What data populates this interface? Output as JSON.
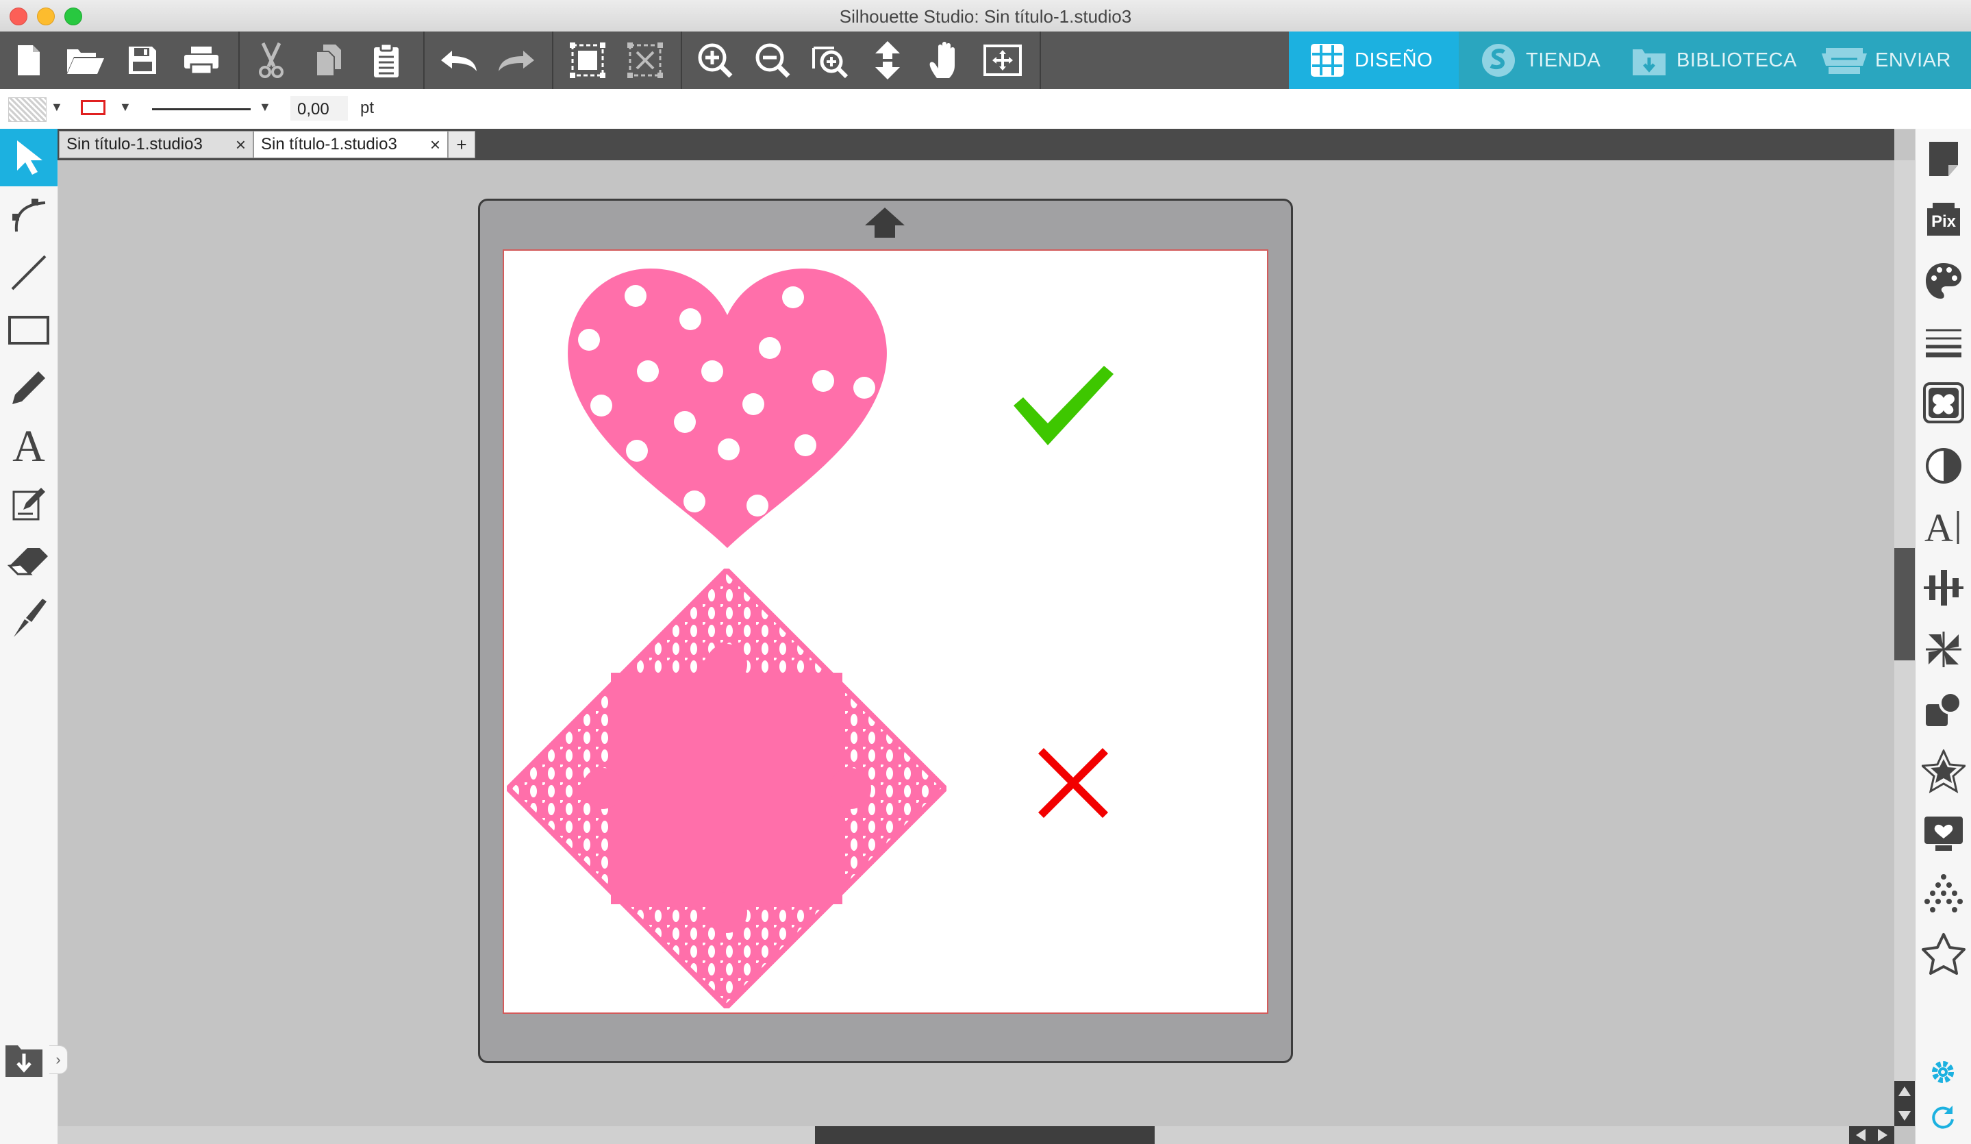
{
  "window": {
    "title": "Silhouette Studio: Sin título-1.studio3"
  },
  "toolbar": {
    "file_buttons": [
      "new-document-icon",
      "open-folder-icon",
      "save-icon",
      "print-icon"
    ],
    "edit_buttons": [
      "cut-icon",
      "copy-icon",
      "paste-icon"
    ],
    "history_buttons": [
      "undo-icon",
      "redo-icon"
    ],
    "group_buttons": [
      "group-icon",
      "ungroup-icon"
    ],
    "view_buttons": [
      "zoom-in-icon",
      "zoom-out-icon",
      "zoom-select-icon",
      "pan-move-icon",
      "hand-icon",
      "fit-to-page-icon"
    ],
    "modes": [
      {
        "label": "DISEÑO",
        "icon": "design-grid-icon",
        "active": true
      },
      {
        "label": "TIENDA",
        "icon": "silhouette-store-icon",
        "active": false
      },
      {
        "label": "BIBLIOTECA",
        "icon": "library-download-icon",
        "active": false
      },
      {
        "label": "ENVIAR",
        "icon": "send-cutter-icon",
        "active": false
      }
    ],
    "accent_active": "#1cb1e0",
    "accent_inactive": "#2aa6bf"
  },
  "properties": {
    "line_width_value": "0,00",
    "line_width_unit": "pt",
    "line_color": "#e02020"
  },
  "left_tools": [
    "select-arrow-icon",
    "point-edit-icon",
    "line-tool-icon",
    "rectangle-tool-icon",
    "pencil-tool-icon",
    "text-tool-icon",
    "sketch-tool-icon",
    "eraser-tool-icon",
    "knife-tool-icon"
  ],
  "library_toggle_icon": "library-panel-icon",
  "tabs": [
    {
      "label": "Sin título-1.studio3",
      "close": "×",
      "active": false
    },
    {
      "label": "Sin título-1.studio3",
      "close": "×",
      "active": true
    }
  ],
  "new_tab_label": "+",
  "right_panel": [
    "page-setup-icon",
    "pixscan-icon",
    "fill-color-icon",
    "line-style-icon",
    "trace-icon",
    "contrast-icon",
    "text-style-icon",
    "align-icon",
    "replicate-icon",
    "modify-icon",
    "offset-star-icon",
    "design-store-icon",
    "rhinestone-icon",
    "star-outline-icon",
    "settings-gear-icon",
    "refresh-icon"
  ],
  "canvas": {
    "designs": [
      {
        "name": "polka-dot-heart",
        "color": "#ff6faa"
      },
      {
        "name": "lace-diamond",
        "color": "#ff6faa"
      }
    ],
    "marks": [
      {
        "name": "checkmark-icon",
        "color": "#3ec700"
      },
      {
        "name": "cross-mark-icon",
        "color": "#f20000"
      }
    ],
    "mat_color": "#a1a1a3",
    "sheet_border": "#d35b5b"
  }
}
